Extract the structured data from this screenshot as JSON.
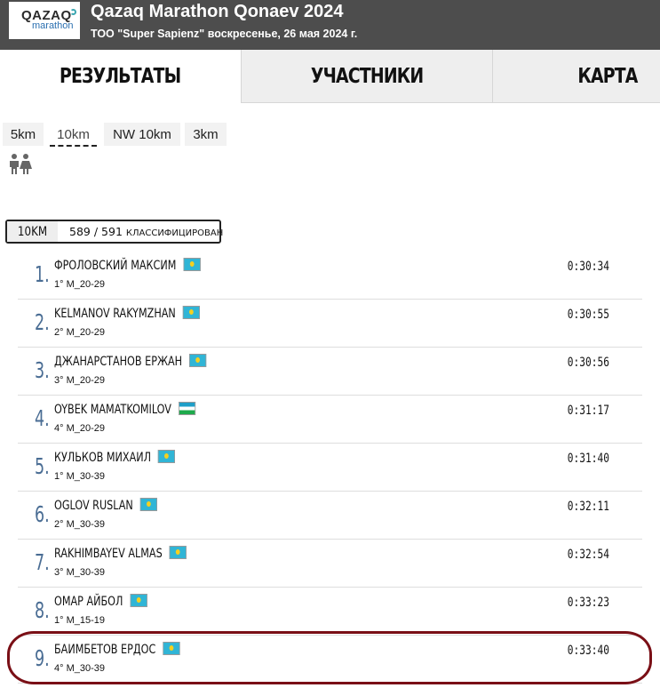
{
  "header": {
    "logo_top": "QAZAQ",
    "logo_bottom": "marathon",
    "title": "Qazaq Marathon Qonaev 2024",
    "subtitle": "ТОО \"Super Sapienz\" воскресенье, 26 мая 2024 г."
  },
  "tabs": [
    {
      "label": "РЕЗУЛЬТАТЫ",
      "active": true
    },
    {
      "label": "УЧАСТНИКИ",
      "active": false
    },
    {
      "label": "КАРТА",
      "active": false
    }
  ],
  "distances": [
    {
      "label": "5km",
      "selected": false
    },
    {
      "label": "10km",
      "selected": true
    },
    {
      "label": "NW 10km",
      "selected": false
    },
    {
      "label": "3km",
      "selected": false
    }
  ],
  "gender_filter_icon": "people-icon",
  "summary": {
    "distance": "10KM",
    "classified": "589",
    "separator": "/",
    "total": "591",
    "label": "КЛАССИФИЦИРОВАН"
  },
  "results": [
    {
      "rank": "1.",
      "name": "ФРОЛОВСКИЙ МАКСИМ",
      "flag": "kz",
      "category": "1° M_20-29",
      "time": "0:30:34"
    },
    {
      "rank": "2.",
      "name": "KELMANOV RAKYMZHAN",
      "flag": "kz",
      "category": "2° M_20-29",
      "time": "0:30:55"
    },
    {
      "rank": "3.",
      "name": "ДЖАНАРСТАНОВ ЕРЖАН",
      "flag": "kz",
      "category": "3° M_20-29",
      "time": "0:30:56"
    },
    {
      "rank": "4.",
      "name": "OYBEK MAMATKOMILOV",
      "flag": "uz",
      "category": "4° M_20-29",
      "time": "0:31:17"
    },
    {
      "rank": "5.",
      "name": "КУЛЬКОВ МИХАИЛ",
      "flag": "kz",
      "category": "1° M_30-39",
      "time": "0:31:40"
    },
    {
      "rank": "6.",
      "name": "OGLOV RUSLAN",
      "flag": "kz",
      "category": "2° M_30-39",
      "time": "0:32:11"
    },
    {
      "rank": "7.",
      "name": "RAKHIMBAYEV ALMAS",
      "flag": "kz",
      "category": "3° M_30-39",
      "time": "0:32:54"
    },
    {
      "rank": "8.",
      "name": "ОМАР АЙБОЛ",
      "flag": "kz",
      "category": "1° M_15-19",
      "time": "0:33:23"
    },
    {
      "rank": "9.",
      "name": "БАИМБЕТОВ ЕРДОС",
      "flag": "kz",
      "category": "4° M_30-39",
      "time": "0:33:40"
    }
  ],
  "colors": {
    "header_bg": "#4d4d4d",
    "rank": "#4a6d94",
    "highlight": "#7a0f16"
  }
}
